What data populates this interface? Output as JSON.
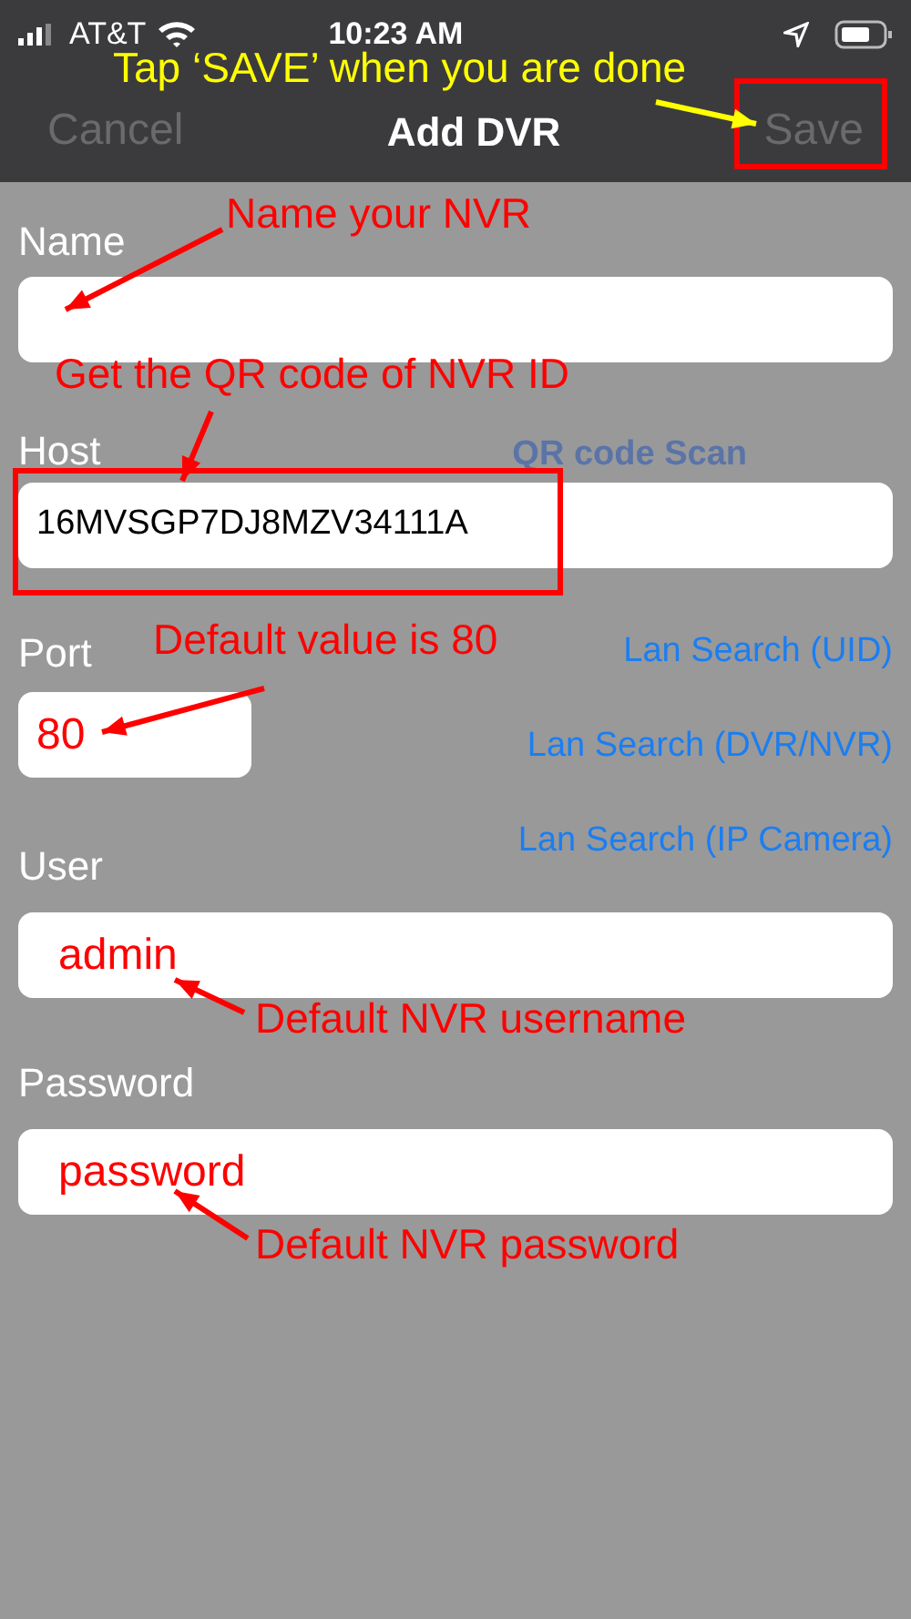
{
  "status_bar": {
    "carrier": "AT&T",
    "time": "10:23 AM"
  },
  "nav": {
    "cancel": {
      "label": "Cancel",
      "disabled": true
    },
    "title": "Add DVR",
    "save": {
      "label": "Save",
      "disabled": true
    }
  },
  "fields": [
    {
      "label": "Name"
    },
    {
      "label": "Host",
      "value": "16MVSGP7DJ8MZV34111A",
      "link": {
        "label": "QR code Scan",
        "disabled": true
      }
    },
    {
      "label": "Port",
      "annotation": "80",
      "links": [
        {
          "label": "Lan Search (UID)",
          "disabled": false
        },
        {
          "label": "Lan Search (DVR/NVR)",
          "disabled": false
        },
        {
          "label": "Lan Search (IP Camera)",
          "disabled": false
        }
      ]
    },
    {
      "label": "User",
      "annotation": "admin"
    },
    {
      "label": "Password",
      "annotation": "password"
    }
  ],
  "callouts": [
    {
      "text": "Tap ‘SAVE’ when you are done",
      "color": "#ffff00"
    },
    {
      "text": "Name your NVR",
      "color": "#ff0000"
    },
    {
      "text": "Get the QR code of NVR ID",
      "color": "#ff0000"
    },
    {
      "text": "Default value is 80",
      "color": "#ff0000"
    },
    {
      "text": "Default NVR username",
      "color": "#ff0000"
    },
    {
      "text": "Default NVR password",
      "color": "#ff0000"
    }
  ]
}
